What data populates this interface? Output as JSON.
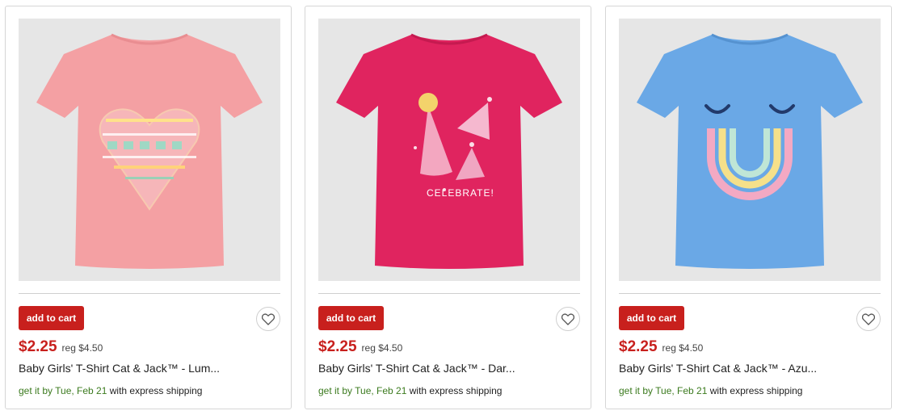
{
  "products": [
    {
      "name": "Baby Girls' T-Shirt Cat & Jack™ - Lum...",
      "price": "$2.25",
      "reg_price": "reg $4.50",
      "add_to_cart": "add to cart",
      "shipping_lead": "get it by ",
      "ship_date": "Tue, Feb 21",
      "shipping_tail": " with express shipping",
      "shirt_color": "#f4a0a3",
      "favorite_icon": "heart-outline-icon"
    },
    {
      "name": "Baby Girls' T-Shirt Cat & Jack™ - Dar...",
      "price": "$2.25",
      "reg_price": "reg $4.50",
      "add_to_cart": "add to cart",
      "shipping_lead": "get it by ",
      "ship_date": "Tue, Feb 21",
      "shipping_tail": " with express shipping",
      "shirt_color": "#e0245f",
      "shirt_graphic_text": "CELEBRATE!",
      "favorite_icon": "heart-outline-icon"
    },
    {
      "name": "Baby Girls' T-Shirt Cat & Jack™ - Azu...",
      "price": "$2.25",
      "reg_price": "reg $4.50",
      "add_to_cart": "add to cart",
      "shipping_lead": "get it by ",
      "ship_date": "Tue, Feb 21",
      "shipping_tail": " with express shipping",
      "shirt_color": "#6aa8e6",
      "favorite_icon": "heart-outline-icon"
    }
  ],
  "colors": {
    "accent_red": "#c8201d",
    "shipping_green": "#3b7a1e",
    "image_background": "#e6e6e6"
  }
}
